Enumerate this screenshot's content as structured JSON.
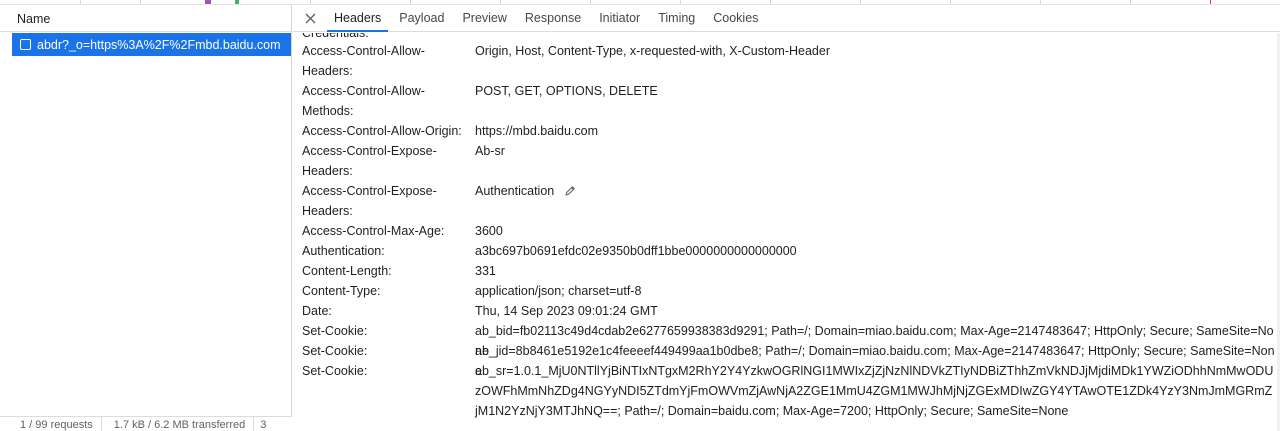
{
  "request_list": {
    "header": "Name",
    "selected_request": "abdr?_o=https%3A%2F%2Fmbd.baidu.com",
    "status": {
      "requests": "1 / 99 requests",
      "transferred": "1.7 kB / 6.2 MB transferred",
      "more": "3"
    }
  },
  "tabs": [
    {
      "label": "Headers",
      "active": true
    },
    {
      "label": "Payload"
    },
    {
      "label": "Preview"
    },
    {
      "label": "Response"
    },
    {
      "label": "Initiator"
    },
    {
      "label": "Timing"
    },
    {
      "label": "Cookies"
    }
  ],
  "close_icon": "close-icon",
  "partial_top_line": "Credentials:",
  "headers": [
    {
      "name": "Access-Control-Allow-Headers:",
      "value": "Origin, Host, Content-Type, x-requested-with, X-Custom-Header"
    },
    {
      "name": "Access-Control-Allow-Methods:",
      "value": "POST, GET, OPTIONS, DELETE"
    },
    {
      "name": "Access-Control-Allow-Origin:",
      "value": "https://mbd.baidu.com"
    },
    {
      "name": "Access-Control-Expose-Headers:",
      "value": "Ab-sr"
    },
    {
      "name": "Access-Control-Expose-Headers:",
      "value": "Authentication",
      "editable": true
    },
    {
      "name": "Access-Control-Max-Age:",
      "value": "3600"
    },
    {
      "name": "Authentication:",
      "value": "a3bc697b0691efdc02e9350b0dff1bbe0000000000000000"
    },
    {
      "name": "Content-Length:",
      "value": "331"
    },
    {
      "name": "Content-Type:",
      "value": "application/json; charset=utf-8"
    },
    {
      "name": "Date:",
      "value": "Thu, 14 Sep 2023 09:01:24 GMT"
    },
    {
      "name": "Set-Cookie:",
      "value": "ab_bid=fb02113c49d4cdab2e6277659938383d9291; Path=/; Domain=miao.baidu.com; Max-Age=2147483647; HttpOnly; Secure; SameSite=None"
    },
    {
      "name": "Set-Cookie:",
      "value": "ab_jid=8b8461e5192e1c4feeeef449499aa1b0dbe8; Path=/; Domain=miao.baidu.com; Max-Age=2147483647; HttpOnly; Secure; SameSite=None"
    },
    {
      "name": "Set-Cookie:",
      "value": "ab_sr=1.0.1_MjU0NTllYjBiNTIxNTgxM2RhY2Y4YzkwOGRlNGI1MWIxZjZjNzNlNDVkZTIyNDBiZThhZmVkNDJjMjdiMDk1YWZiODhhNmMwODUzOWFhMmNhZDg4NGYyNDI5ZTdmYjFmOWVmZjAwNjA2ZGE1MmU4ZGM1MWJhMjNjZGExMDIwZGY4YTAwOTE1ZDk4YzY3NmJmMGRmZjM1N2YzNjY3MTJhNQ==; Path=/; Domain=baidu.com; Max-Age=7200; HttpOnly; Secure; SameSite=None"
    }
  ],
  "colors": {
    "selection": "#1a73e8",
    "active_tab_underline": "#1a73e8"
  }
}
